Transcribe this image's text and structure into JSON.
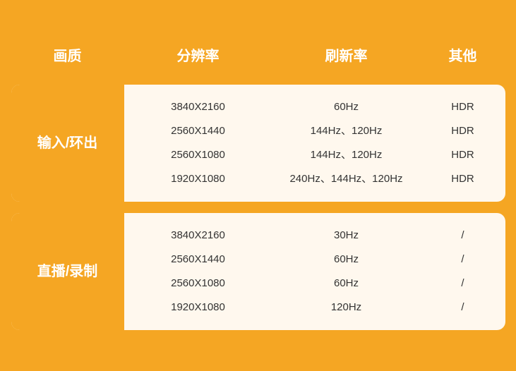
{
  "header": {
    "col1": "画质",
    "col2": "分辨率",
    "col3": "刷新率",
    "col4": "其他"
  },
  "rows": [
    {
      "label": "输入/环出",
      "resolutions": [
        "3840X2160",
        "2560X1440",
        "2560X1080",
        "1920X1080"
      ],
      "refresh_rates": [
        "60Hz",
        "144Hz、120Hz",
        "144Hz、120Hz",
        "240Hz、144Hz、120Hz"
      ],
      "other": [
        "HDR",
        "HDR",
        "HDR",
        "HDR"
      ]
    },
    {
      "label": "直播/录制",
      "resolutions": [
        "3840X2160",
        "2560X1440",
        "2560X1080",
        "1920X1080"
      ],
      "refresh_rates": [
        "30Hz",
        "60Hz",
        "60Hz",
        "120Hz"
      ],
      "other": [
        "/",
        "/",
        "/",
        "/"
      ]
    }
  ],
  "accent_color": "#f5a623",
  "bg_light": "#fff8ee",
  "text_white": "#ffffff",
  "text_dark": "#333333"
}
